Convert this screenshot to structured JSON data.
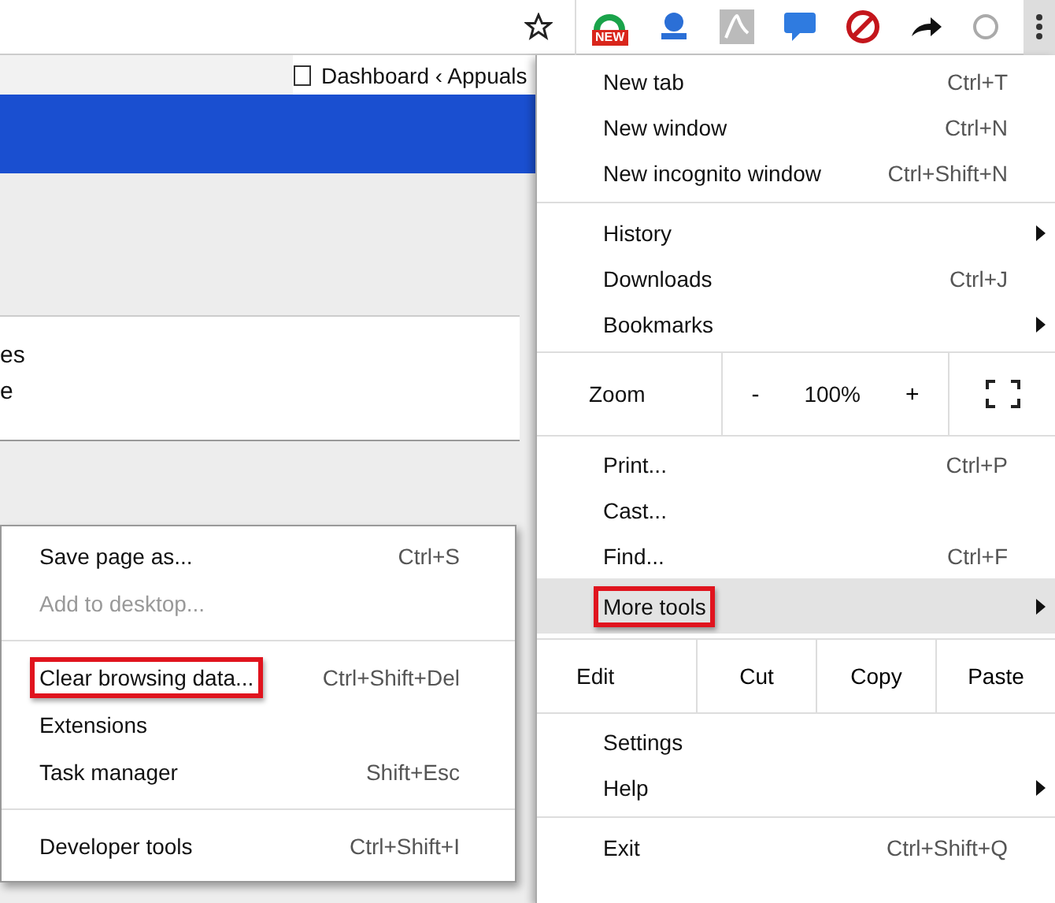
{
  "toolbar": {
    "extension_badge": "NEW"
  },
  "tab": {
    "title": "Dashboard ‹ Appuals"
  },
  "page": {
    "lines": [
      "es",
      "e"
    ]
  },
  "menu": {
    "items": [
      {
        "kind": "item",
        "label": "New tab",
        "shortcut": "Ctrl+T",
        "submenu": false,
        "selected": false,
        "outlined": false
      },
      {
        "kind": "item",
        "label": "New window",
        "shortcut": "Ctrl+N",
        "submenu": false,
        "selected": false,
        "outlined": false
      },
      {
        "kind": "item",
        "label": "New incognito window",
        "shortcut": "Ctrl+Shift+N",
        "submenu": false,
        "selected": false,
        "outlined": false
      },
      {
        "kind": "divider"
      },
      {
        "kind": "item",
        "label": "History",
        "submenu": true,
        "selected": false,
        "outlined": false
      },
      {
        "kind": "item",
        "label": "Downloads",
        "shortcut": "Ctrl+J",
        "submenu": false,
        "selected": false,
        "outlined": false
      },
      {
        "kind": "item",
        "label": "Bookmarks",
        "submenu": true,
        "selected": false,
        "outlined": false
      },
      {
        "kind": "zoom",
        "label": "Zoom",
        "minus": "-",
        "value": "100%",
        "plus": "+"
      },
      {
        "kind": "item",
        "label": "Print...",
        "shortcut": "Ctrl+P",
        "submenu": false,
        "selected": false,
        "outlined": false
      },
      {
        "kind": "item",
        "label": "Cast...",
        "submenu": false,
        "selected": false,
        "outlined": false
      },
      {
        "kind": "item",
        "label": "Find...",
        "shortcut": "Ctrl+F",
        "submenu": false,
        "selected": false,
        "outlined": false
      },
      {
        "kind": "item",
        "label": "More tools",
        "submenu": true,
        "selected": true,
        "outlined": true
      },
      {
        "kind": "edit",
        "label": "Edit",
        "buttons": [
          "Cut",
          "Copy",
          "Paste"
        ]
      },
      {
        "kind": "item",
        "label": "Settings",
        "submenu": false,
        "selected": false,
        "outlined": false
      },
      {
        "kind": "item",
        "label": "Help",
        "submenu": true,
        "selected": false,
        "outlined": false
      },
      {
        "kind": "divider"
      },
      {
        "kind": "item",
        "label": "Exit",
        "shortcut": "Ctrl+Shift+Q",
        "submenu": false,
        "selected": false,
        "outlined": false
      }
    ]
  },
  "submenu": {
    "items": [
      {
        "kind": "item",
        "label": "Save page as...",
        "shortcut": "Ctrl+S",
        "disabled": false,
        "outlined": false
      },
      {
        "kind": "item",
        "label": "Add to desktop...",
        "disabled": true,
        "outlined": false
      },
      {
        "kind": "divider"
      },
      {
        "kind": "item",
        "label": "Clear browsing data...",
        "shortcut": "Ctrl+Shift+Del",
        "disabled": false,
        "outlined": true
      },
      {
        "kind": "item",
        "label": "Extensions",
        "disabled": false,
        "outlined": false
      },
      {
        "kind": "item",
        "label": "Task manager",
        "shortcut": "Shift+Esc",
        "disabled": false,
        "outlined": false
      },
      {
        "kind": "divider"
      },
      {
        "kind": "item",
        "label": "Developer tools",
        "shortcut": "Ctrl+Shift+I",
        "disabled": false,
        "outlined": false
      }
    ]
  }
}
